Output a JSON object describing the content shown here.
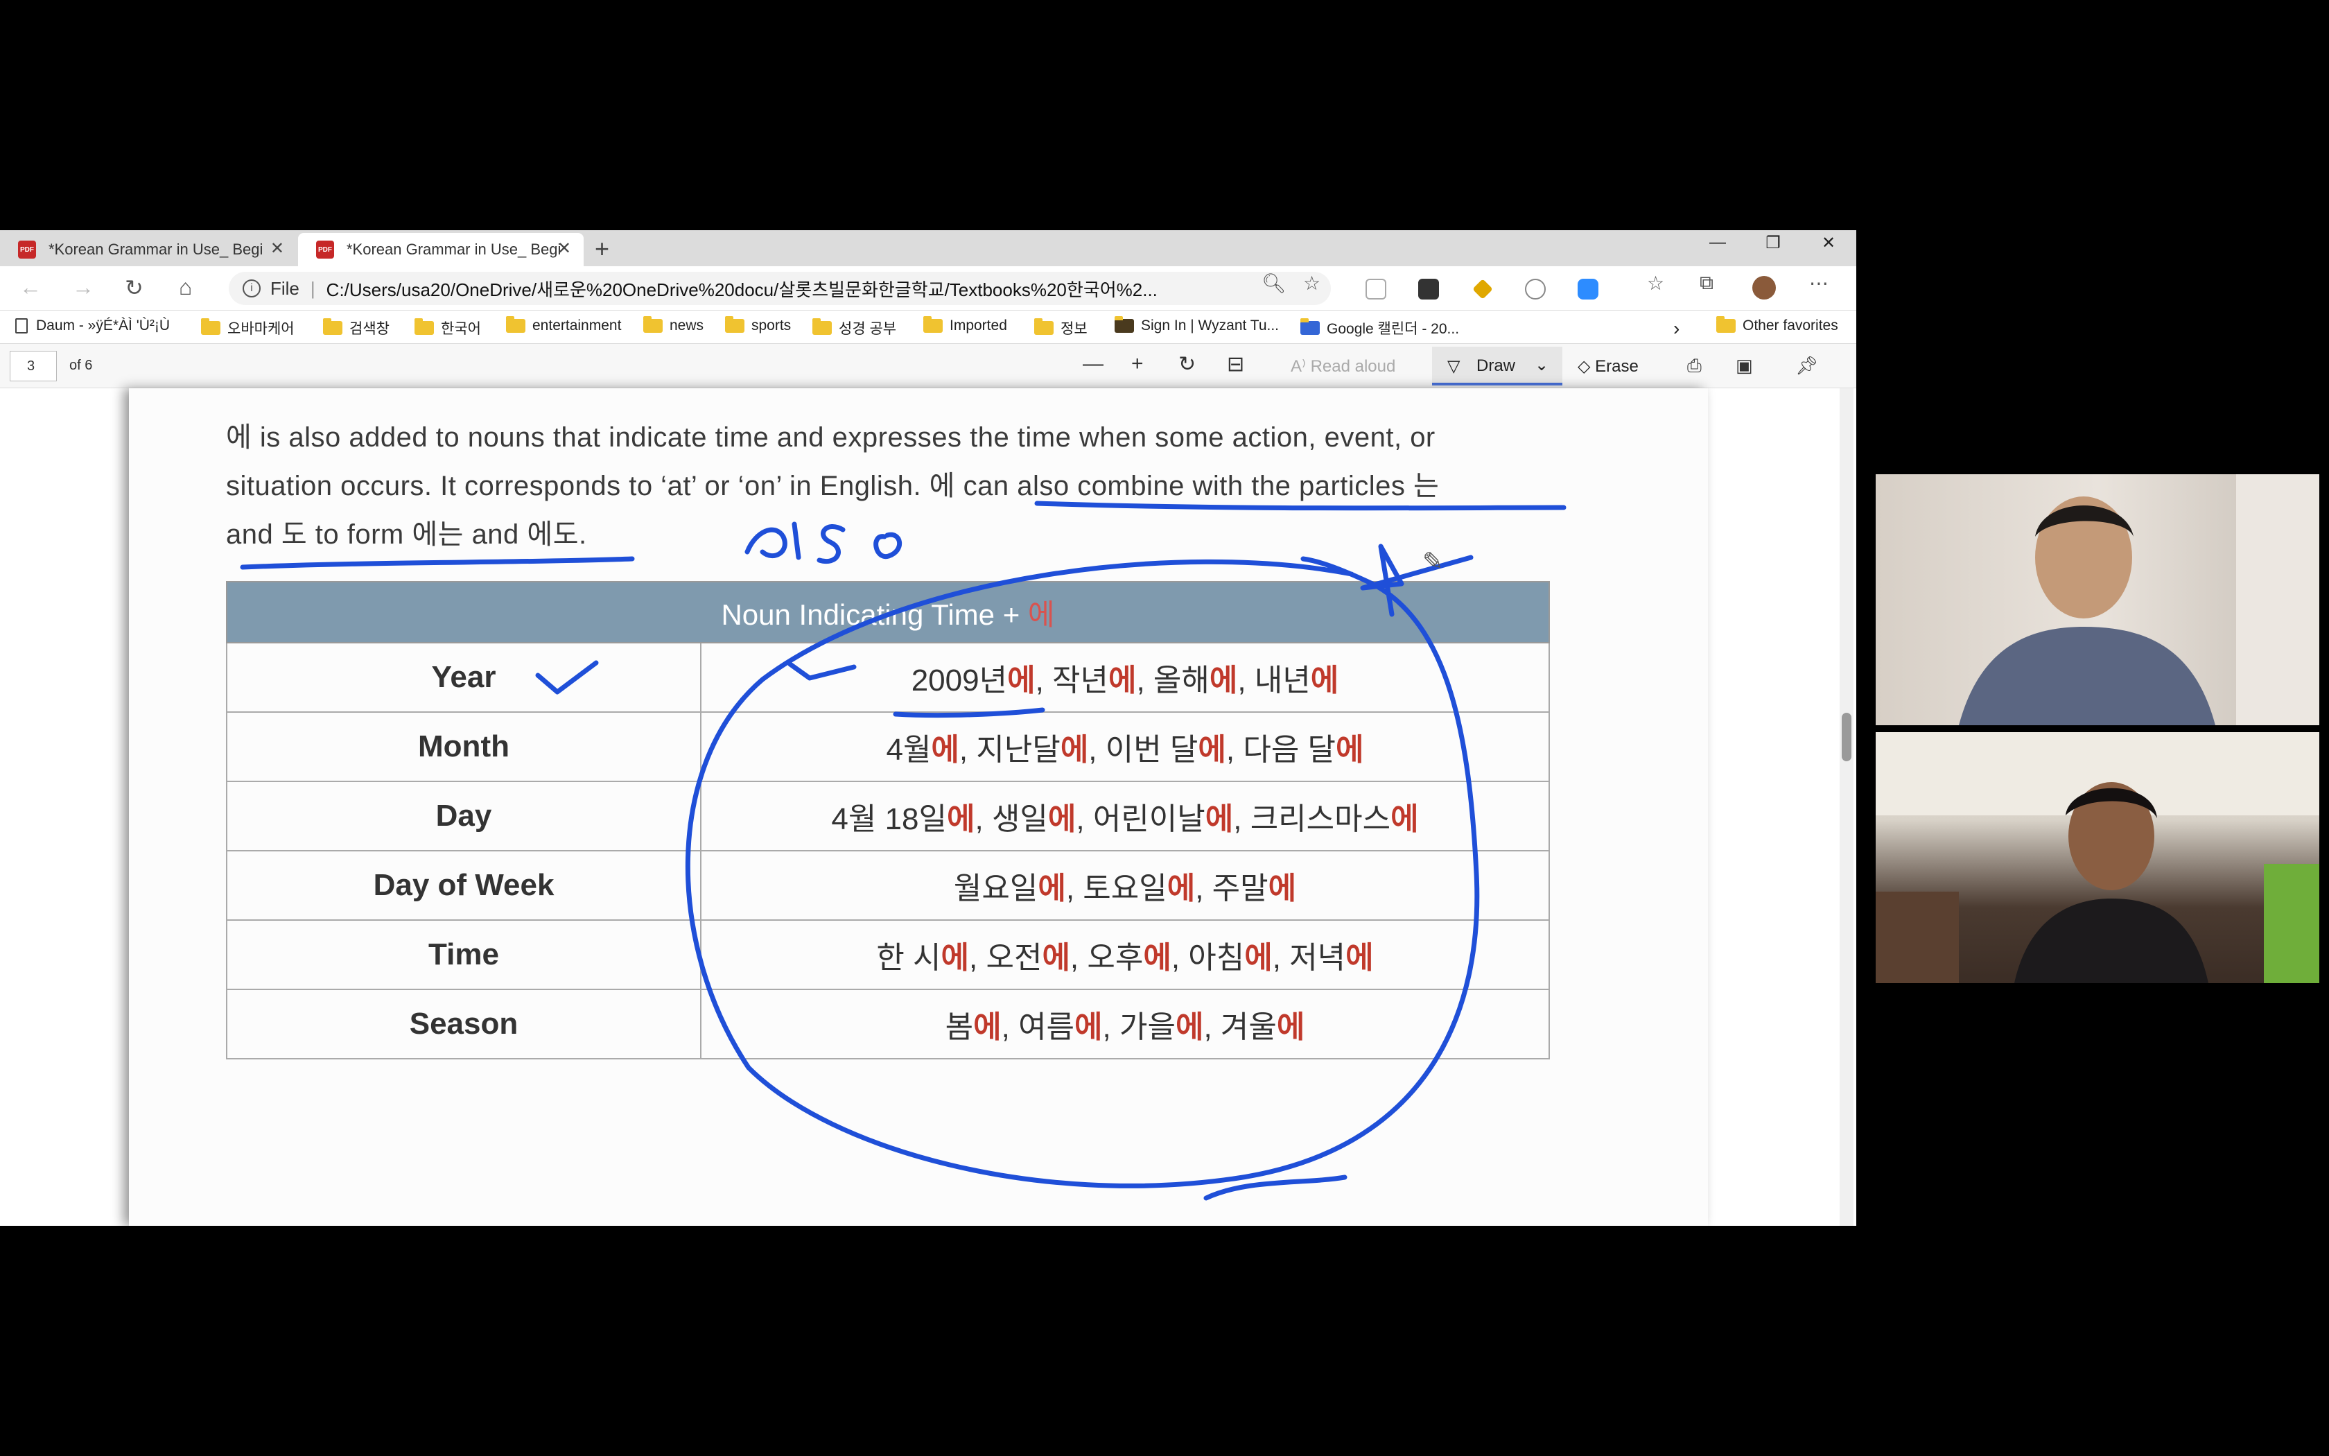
{
  "tabs": [
    {
      "title": "*Korean Grammar in Use_ Beginn",
      "active": false
    },
    {
      "title": "*Korean Grammar in Use_ Beginn",
      "active": true
    }
  ],
  "address_bar": {
    "file_label": "File",
    "url": "C:/Users/usa20/OneDrive/새로운%20OneDrive%20docu/살롯츠빌문화한글학교/Textbooks%20한국어%2..."
  },
  "bookmarks": [
    {
      "label": "Daum - »ÿÉ*ÀÌ 'Ù²¡Ù",
      "icon": "page-icon"
    },
    {
      "label": "오바마케어",
      "icon": "folder-icon"
    },
    {
      "label": "검색창",
      "icon": "folder-icon"
    },
    {
      "label": "한국어",
      "icon": "folder-icon"
    },
    {
      "label": "entertainment",
      "icon": "folder-icon"
    },
    {
      "label": "news",
      "icon": "folder-icon"
    },
    {
      "label": "sports",
      "icon": "folder-icon"
    },
    {
      "label": "성경 공부",
      "icon": "folder-icon"
    },
    {
      "label": "Imported",
      "icon": "folder-icon"
    },
    {
      "label": "정보",
      "icon": "folder-icon"
    },
    {
      "label": "Sign In | Wyzant Tu...",
      "icon": "wyzant-icon"
    },
    {
      "label": "Google 캘린더 - 20...",
      "icon": "calendar-icon"
    }
  ],
  "other_favorites": "Other favorites",
  "pdf_toolbar": {
    "page_number": "3",
    "page_of": "of 6",
    "read_aloud": "Read aloud",
    "draw": "Draw",
    "erase": "Erase"
  },
  "document": {
    "line1": "에 is also added to nouns that indicate time and expresses the time when some action, event, or",
    "line2": "situation occurs. It corresponds to ‘at’ or ‘on’ in English. 에 can also combine with the particles 는",
    "line3": "and 도 to form 에는 and 에도.",
    "table_header_text": "Noun Indicating Time + ",
    "table_header_particle": "에",
    "rows": [
      {
        "label": "Year",
        "examples": [
          [
            "2009년",
            "에"
          ],
          [
            "작년",
            "에"
          ],
          [
            "올해",
            "에"
          ],
          [
            "내년",
            "에"
          ]
        ]
      },
      {
        "label": "Month",
        "examples": [
          [
            "4월",
            "에"
          ],
          [
            "지난달",
            "에"
          ],
          [
            "이번 달",
            "에"
          ],
          [
            "다음 달",
            "에"
          ]
        ]
      },
      {
        "label": "Day",
        "examples": [
          [
            "4월 18일",
            "에"
          ],
          [
            "생일",
            "에"
          ],
          [
            "어린이날",
            "에"
          ],
          [
            "크리스마스",
            "에"
          ]
        ]
      },
      {
        "label": "Day of Week",
        "examples": [
          [
            "월요일",
            "에"
          ],
          [
            "토요일",
            "에"
          ],
          [
            "주말",
            "에"
          ]
        ]
      },
      {
        "label": "Time",
        "examples": [
          [
            "한 시",
            "에"
          ],
          [
            "오전",
            "에"
          ],
          [
            "오후",
            "에"
          ],
          [
            "아침",
            "에"
          ],
          [
            "저녁",
            "에"
          ]
        ]
      },
      {
        "label": "Season",
        "examples": [
          [
            "봄",
            "에"
          ],
          [
            "여름",
            "에"
          ],
          [
            "가을",
            "에"
          ],
          [
            "겨울",
            "에"
          ]
        ]
      }
    ]
  },
  "annotation": {
    "handwritten_word": "also",
    "color": "#1f4fd8"
  },
  "colors": {
    "particle_red": "#c0392b",
    "table_header": "#7f9aae",
    "ink_blue": "#1f4fd8"
  },
  "video_participants": [
    {
      "name": "participant-1"
    },
    {
      "name": "participant-2"
    }
  ]
}
